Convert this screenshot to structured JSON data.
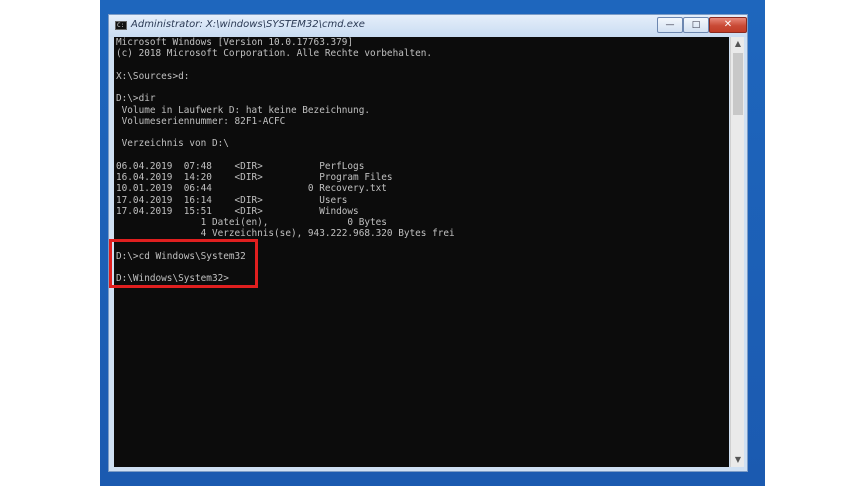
{
  "window": {
    "title": "Administrator: X:\\windows\\SYSTEM32\\cmd.exe",
    "icon": "cmd-icon",
    "controls": {
      "minimize_glyph": "—",
      "maximize_glyph": "□",
      "close_glyph": "✕"
    }
  },
  "console": {
    "lines": [
      "Microsoft Windows [Version 10.0.17763.379]",
      "(c) 2018 Microsoft Corporation. Alle Rechte vorbehalten.",
      "",
      "X:\\Sources>d:",
      "",
      "D:\\>dir",
      " Volume in Laufwerk D: hat keine Bezeichnung.",
      " Volumeseriennummer: 82F1-ACFC",
      "",
      " Verzeichnis von D:\\",
      "",
      "06.04.2019  07:48    <DIR>          PerfLogs",
      "16.04.2019  14:20    <DIR>          Program Files",
      "10.01.2019  06:44                 0 Recovery.txt",
      "17.04.2019  16:14    <DIR>          Users",
      "17.04.2019  15:51    <DIR>          Windows",
      "               1 Datei(en),              0 Bytes",
      "               4 Verzeichnis(se), 943.222.968.320 Bytes frei",
      "",
      "D:\\>cd Windows\\System32",
      "",
      "D:\\Windows\\System32>"
    ]
  },
  "scrollbar": {
    "up_glyph": "▲",
    "down_glyph": "▼"
  },
  "colors": {
    "console_bg": "#0c0c0c",
    "console_text": "#c0c0c0",
    "highlight": "#e01f1f",
    "desktop": "#1b5ab0"
  }
}
